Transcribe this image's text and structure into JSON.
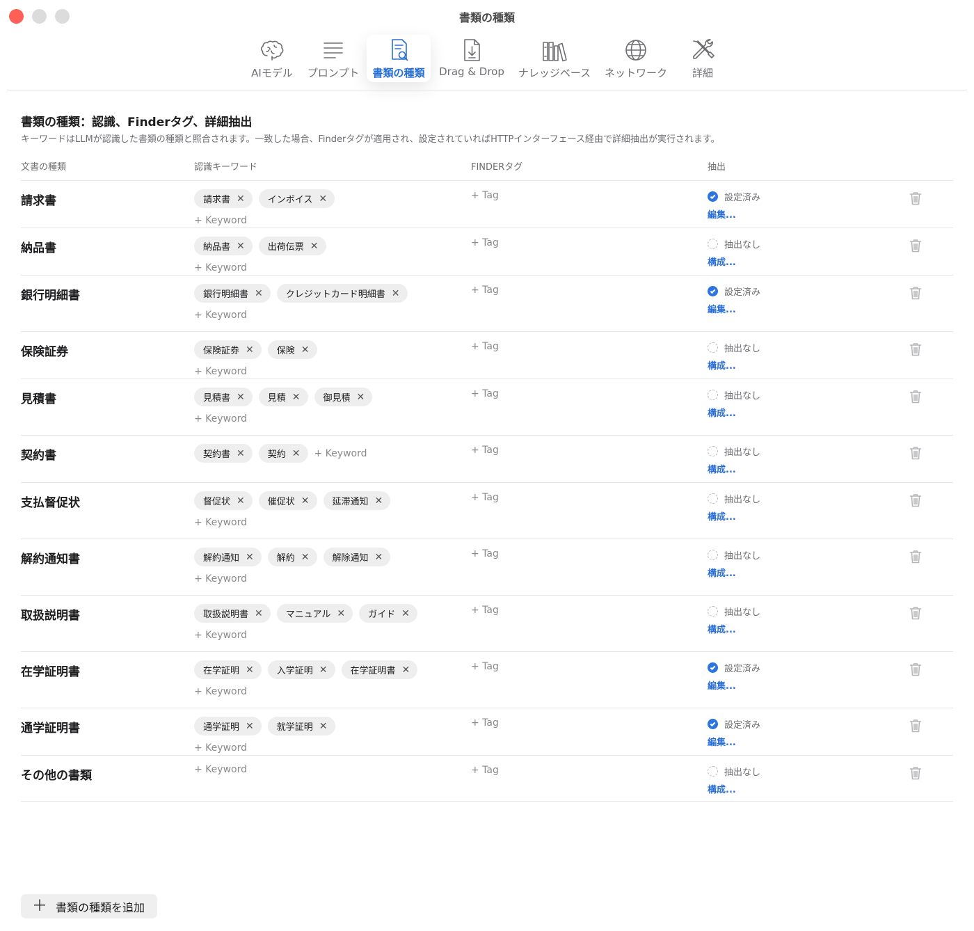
{
  "window": {
    "title": "書類の種類"
  },
  "tabs": [
    {
      "label": "AIモデル",
      "icon": "brain-icon",
      "active": false
    },
    {
      "label": "プロンプト",
      "icon": "text-lines-icon",
      "active": false
    },
    {
      "label": "書類の種類",
      "icon": "document-search-icon",
      "active": true
    },
    {
      "label": "Drag & Drop",
      "icon": "document-download-icon",
      "active": false
    },
    {
      "label": "ナレッジベース",
      "icon": "books-icon",
      "active": false
    },
    {
      "label": "ネットワーク",
      "icon": "globe-icon",
      "active": false
    },
    {
      "label": "詳細",
      "icon": "tools-icon",
      "active": false
    }
  ],
  "section": {
    "title": "書類の種類：認識、Finderタグ、詳細抽出",
    "description": "キーワードはLLMが認識した書類の種類と照合されます。一致した場合、Finderタグが適用され、設定されていればHTTPインターフェース経由で詳細抽出が実行されます。"
  },
  "columns": {
    "type": "文書の種類",
    "keywords": "認識キーワード",
    "finder": "FINDERタグ",
    "extract": "抽出"
  },
  "labels": {
    "add_keyword": "+ Keyword",
    "add_tag": "+ Tag",
    "status_configured": "設定済み",
    "status_none": "抽出なし",
    "link_edit": "編集...",
    "link_configure": "構成...",
    "remove_symbol": "✕"
  },
  "rows": [
    {
      "name": "請求書",
      "keywords": [
        "請求書",
        "インボイス"
      ],
      "configured": true
    },
    {
      "name": "納品書",
      "keywords": [
        "納品書",
        "出荷伝票"
      ],
      "configured": false
    },
    {
      "name": "銀行明細書",
      "keywords": [
        "銀行明細書",
        "クレジットカード明細書"
      ],
      "configured": true
    },
    {
      "name": "保険証券",
      "keywords": [
        "保険証券",
        "保険"
      ],
      "configured": false
    },
    {
      "name": "見積書",
      "keywords": [
        "見積書",
        "見積",
        "御見積"
      ],
      "configured": false
    },
    {
      "name": "契約書",
      "keywords": [
        "契約書",
        "契約"
      ],
      "configured": false
    },
    {
      "name": "支払督促状",
      "keywords": [
        "督促状",
        "催促状",
        "延滞通知"
      ],
      "configured": false
    },
    {
      "name": "解約通知書",
      "keywords": [
        "解約通知",
        "解約",
        "解除通知"
      ],
      "configured": false
    },
    {
      "name": "取扱説明書",
      "keywords": [
        "取扱説明書",
        "マニュアル",
        "ガイド"
      ],
      "configured": false
    },
    {
      "name": "在学証明書",
      "keywords": [
        "在学証明",
        "入学証明",
        "在学証明書"
      ],
      "configured": true
    },
    {
      "name": "通学証明書",
      "keywords": [
        "通学証明",
        "就学証明"
      ],
      "configured": true
    },
    {
      "name": "その他の書類",
      "keywords": [],
      "configured": false
    }
  ],
  "add_button": {
    "label": "書類の種類を追加",
    "icon": "plus-icon"
  }
}
